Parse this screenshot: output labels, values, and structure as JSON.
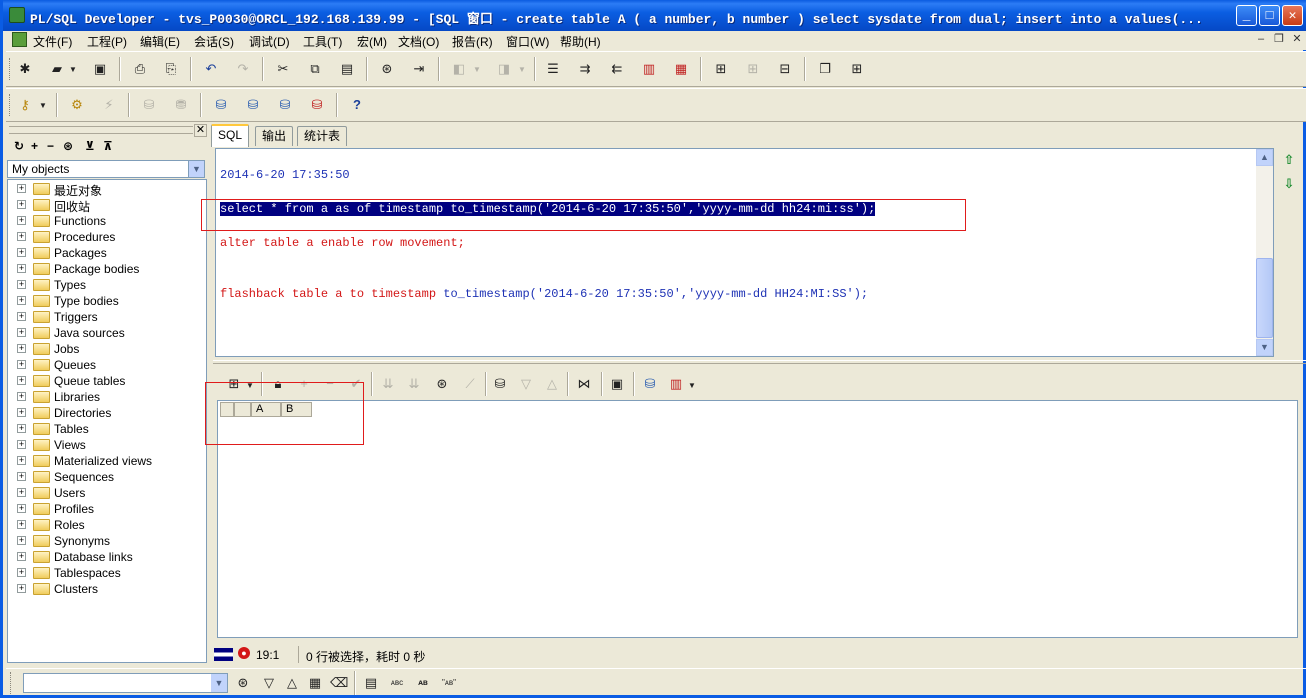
{
  "window": {
    "title": "PL/SQL Developer - tvs_P0030@ORCL_192.168.139.99 - [SQL 窗口 - create table A ( a number, b number ) select sysdate from dual; insert into a values(..."
  },
  "menu": [
    "文件(F)",
    "工程(P)",
    "编辑(E)",
    "会话(S)",
    "调试(D)",
    "工具(T)",
    "宏(M)",
    "文档(O)",
    "报告(R)",
    "窗口(W)",
    "帮助(H)"
  ],
  "browser": {
    "selector": "My objects",
    "nodes": [
      "最近对象",
      "回收站",
      "Functions",
      "Procedures",
      "Packages",
      "Package bodies",
      "Types",
      "Type bodies",
      "Triggers",
      "Java sources",
      "Jobs",
      "Queues",
      "Queue tables",
      "Libraries",
      "Directories",
      "Tables",
      "Views",
      "Materialized views",
      "Sequences",
      "Users",
      "Profiles",
      "Roles",
      "Synonyms",
      "Database links",
      "Tablespaces",
      "Clusters"
    ]
  },
  "tabs": [
    "SQL",
    "输出",
    "统计表"
  ],
  "editor": {
    "timestamp_line": "2014-6-20 17:35:50",
    "select_line": "select * from a as of timestamp to_timestamp('2014-6-20 17:35:50','yyyy-mm-dd hh24:mi:ss');",
    "alter_kw": "alter table a enable row movement;",
    "flashback_kw": "flashback table a to timestamp ",
    "flashback_fn": "to_timestamp('2014-6-20 17:35:50','yyyy-mm-dd HH24:MI:SS');"
  },
  "grid": {
    "columns": [
      "A",
      "B"
    ]
  },
  "status": {
    "position": "19:1",
    "message": "0 行被选择，耗时 0 秒"
  },
  "colors": {
    "keyword": "#d31717",
    "literal": "#1f33b5",
    "selection": "#000080",
    "highlight_box": "#e01b1b"
  }
}
